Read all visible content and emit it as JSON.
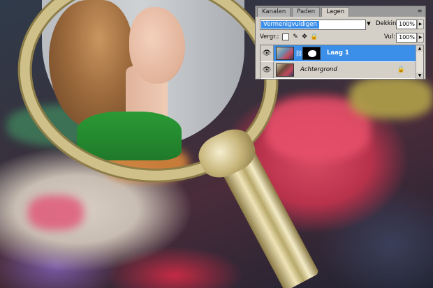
{
  "layers_panel": {
    "tabs": [
      {
        "label": "Kanalen"
      },
      {
        "label": "Paden"
      },
      {
        "label": "Lagen"
      }
    ],
    "active_tab": "Lagen",
    "blend_mode": "Vermenigvuldigen",
    "opacity_label": "Dekking:",
    "opacity_value": "100%",
    "lock_label": "Vergr.:",
    "fill_label": "Vul:",
    "fill_value": "100%",
    "layers": [
      {
        "name": "Laag 1",
        "selected": true,
        "has_mask": true
      },
      {
        "name": "Achtergrond",
        "selected": false,
        "locked": true
      }
    ]
  },
  "colors": {
    "selection": "#3b8fe8",
    "panel_bg": "#d4d0c8"
  },
  "icons": [
    "eye-icon",
    "lock-icon",
    "move-icon",
    "brush-lock-icon",
    "chain-icon",
    "panel-menu-icon"
  ]
}
